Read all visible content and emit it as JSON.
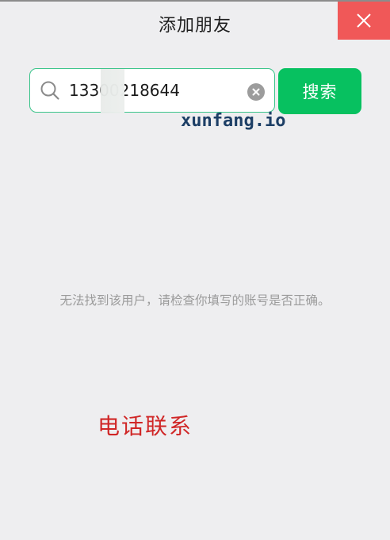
{
  "window": {
    "title": "添加朋友",
    "close_icon": "close-icon"
  },
  "search": {
    "value": "13300218644",
    "placeholder": "",
    "button_label": "搜索",
    "search_icon": "search-icon",
    "clear_icon": "clear-icon"
  },
  "overlay": {
    "watermark": "xunfang.io",
    "contact_stamp": "电话联系"
  },
  "result": {
    "message": "无法找到该用户，请检查你填写的账号是否正确。"
  },
  "colors": {
    "accent": "#07c160",
    "input_border": "#3ac48a",
    "close_bg": "#f05858",
    "background": "#eeeef0",
    "message_text": "#9b9b9b",
    "stamp_red": "#d02626",
    "watermark_blue": "#1d3f66"
  }
}
